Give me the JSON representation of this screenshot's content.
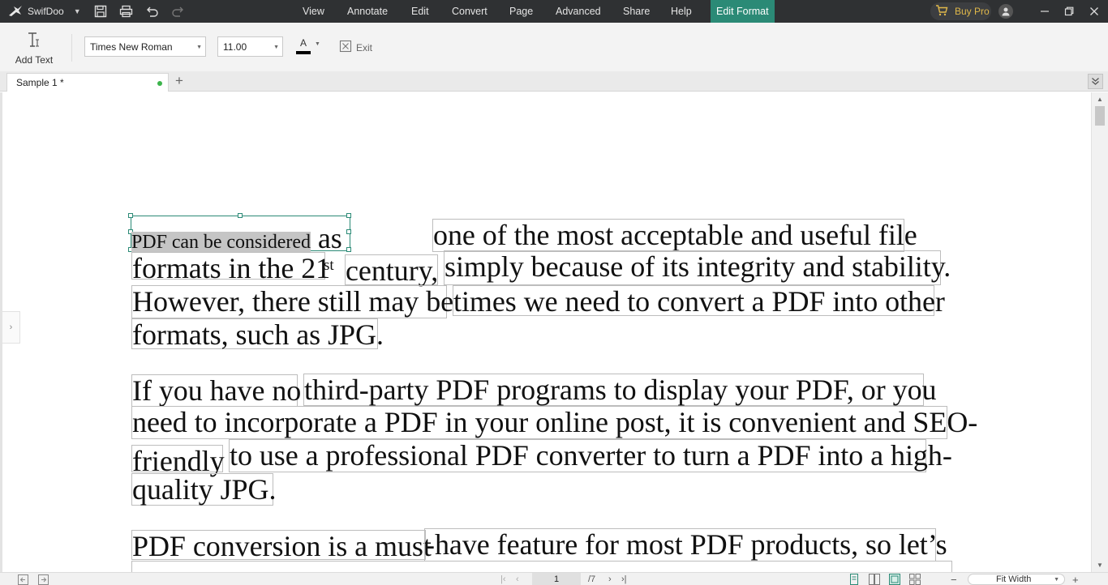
{
  "titlebar": {
    "app_name": "SwifDoo",
    "menus": [
      "View",
      "Annotate",
      "Edit",
      "Convert",
      "Page",
      "Advanced",
      "Share",
      "Help"
    ],
    "active_menu": "Edit Format",
    "buy_label": "Buy Pro"
  },
  "toolbar": {
    "add_text_label": "Add Text",
    "font_name": "Times New Roman",
    "font_size": "11.00",
    "font_color_glyph": "A",
    "exit_label": "Exit"
  },
  "tabs": {
    "document_tab": "Sample 1 *",
    "new_tab_glyph": "+"
  },
  "document": {
    "selected_text": "PDF can be considered",
    "lines": [
      {
        "a": "as",
        "b": "one of the most acceptable and useful file"
      },
      {
        "a": "formats in the 21",
        "sup": "st",
        "b": "century,",
        "c": "simply because of its integrity and stability."
      },
      {
        "a": "However, there still may be",
        "b": "times we need to convert a PDF into other"
      },
      {
        "a": "formats, such as JPG."
      },
      {
        "a": "If you have no",
        "b": "third-party PDF programs to display your PDF, or you"
      },
      {
        "a": "need to incorporate a PDF in your online post, it is convenient and SEO-"
      },
      {
        "a": "friendly",
        "b": "to use a professional PDF converter to turn a PDF into a high-"
      },
      {
        "a": "quality JPG."
      },
      {
        "a": "PDF conversion is a must",
        "b": "-have feature for most PDF products, so let’s"
      }
    ]
  },
  "statusbar": {
    "current_page": "1",
    "total_pages": "/7",
    "zoom": "Fit Width"
  },
  "colors": {
    "accent": "#2b8a76",
    "titlebar_bg": "#2f3133",
    "buy_text": "#e0b84a"
  }
}
